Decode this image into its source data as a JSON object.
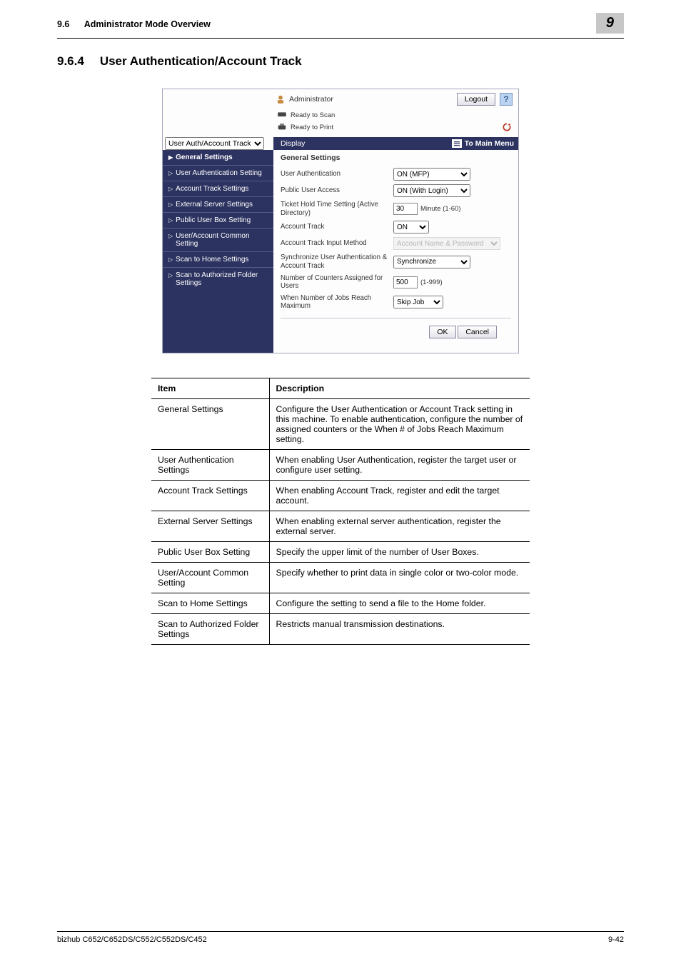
{
  "header": {
    "section_no": "9.6",
    "section_title": "Administrator Mode Overview",
    "chapter_badge": "9"
  },
  "section": {
    "number": "9.6.4",
    "title": "User Authentication/Account Track"
  },
  "screenshot": {
    "admin_label": "Administrator",
    "logout": "Logout",
    "help": "?",
    "ready_scan": "Ready to Scan",
    "ready_print": "Ready to Print",
    "tab_select": "User Auth/Account Track",
    "display_btn": "Display",
    "main_menu": "To Main Menu",
    "sidebar": [
      "General Settings",
      "User Authentication Setting",
      "Account Track Settings",
      "External Server Settings",
      "Public User Box Setting",
      "User/Account Common Setting",
      "Scan to Home Settings",
      "Scan to Authorized Folder Settings"
    ],
    "content": {
      "heading": "General Settings",
      "rows": [
        {
          "label": "User Authentication",
          "field": "ON (MFP)"
        },
        {
          "label": "Public User Access",
          "field": "ON (With Login)"
        },
        {
          "label": "Ticket Hold Time Setting (Active Directory)",
          "input": "30",
          "suffix": "Minute (1-60)"
        },
        {
          "label": "Account Track",
          "field": "ON"
        },
        {
          "label": "Account Track Input Method",
          "field": "Account Name & Password",
          "disabled": true
        },
        {
          "label": "Synchronize User Authentication & Account Track",
          "field": "Synchronize"
        },
        {
          "label": "Number of Counters Assigned for Users",
          "input": "500",
          "range": "(1-999)"
        },
        {
          "label": "When Number of Jobs Reach Maximum",
          "field": "Skip Job"
        }
      ],
      "ok": "OK",
      "cancel": "Cancel"
    }
  },
  "table": {
    "headers": [
      "Item",
      "Description"
    ],
    "rows": [
      [
        "General Settings",
        "Configure the User Authentication or Account Track setting in this machine. To enable authentication, configure the number of assigned counters or the When # of Jobs Reach Maximum setting."
      ],
      [
        "User Authentication Settings",
        "When enabling User Authentication, register the target user or configure user setting."
      ],
      [
        "Account Track Settings",
        "When enabling Account Track, register and edit the target account."
      ],
      [
        "External Server Settings",
        "When enabling external server authentication, register the external server."
      ],
      [
        "Public User Box Setting",
        "Specify the upper limit of the number of User Boxes."
      ],
      [
        "User/Account Common Setting",
        "Specify whether to print data in single color or two-color mode."
      ],
      [
        "Scan to Home Settings",
        "Configure the setting to send a file to the Home folder."
      ],
      [
        "Scan to Authorized Folder Settings",
        "Restricts manual transmission destinations."
      ]
    ]
  },
  "footer": {
    "left": "bizhub C652/C652DS/C552/C552DS/C452",
    "right": "9-42"
  }
}
